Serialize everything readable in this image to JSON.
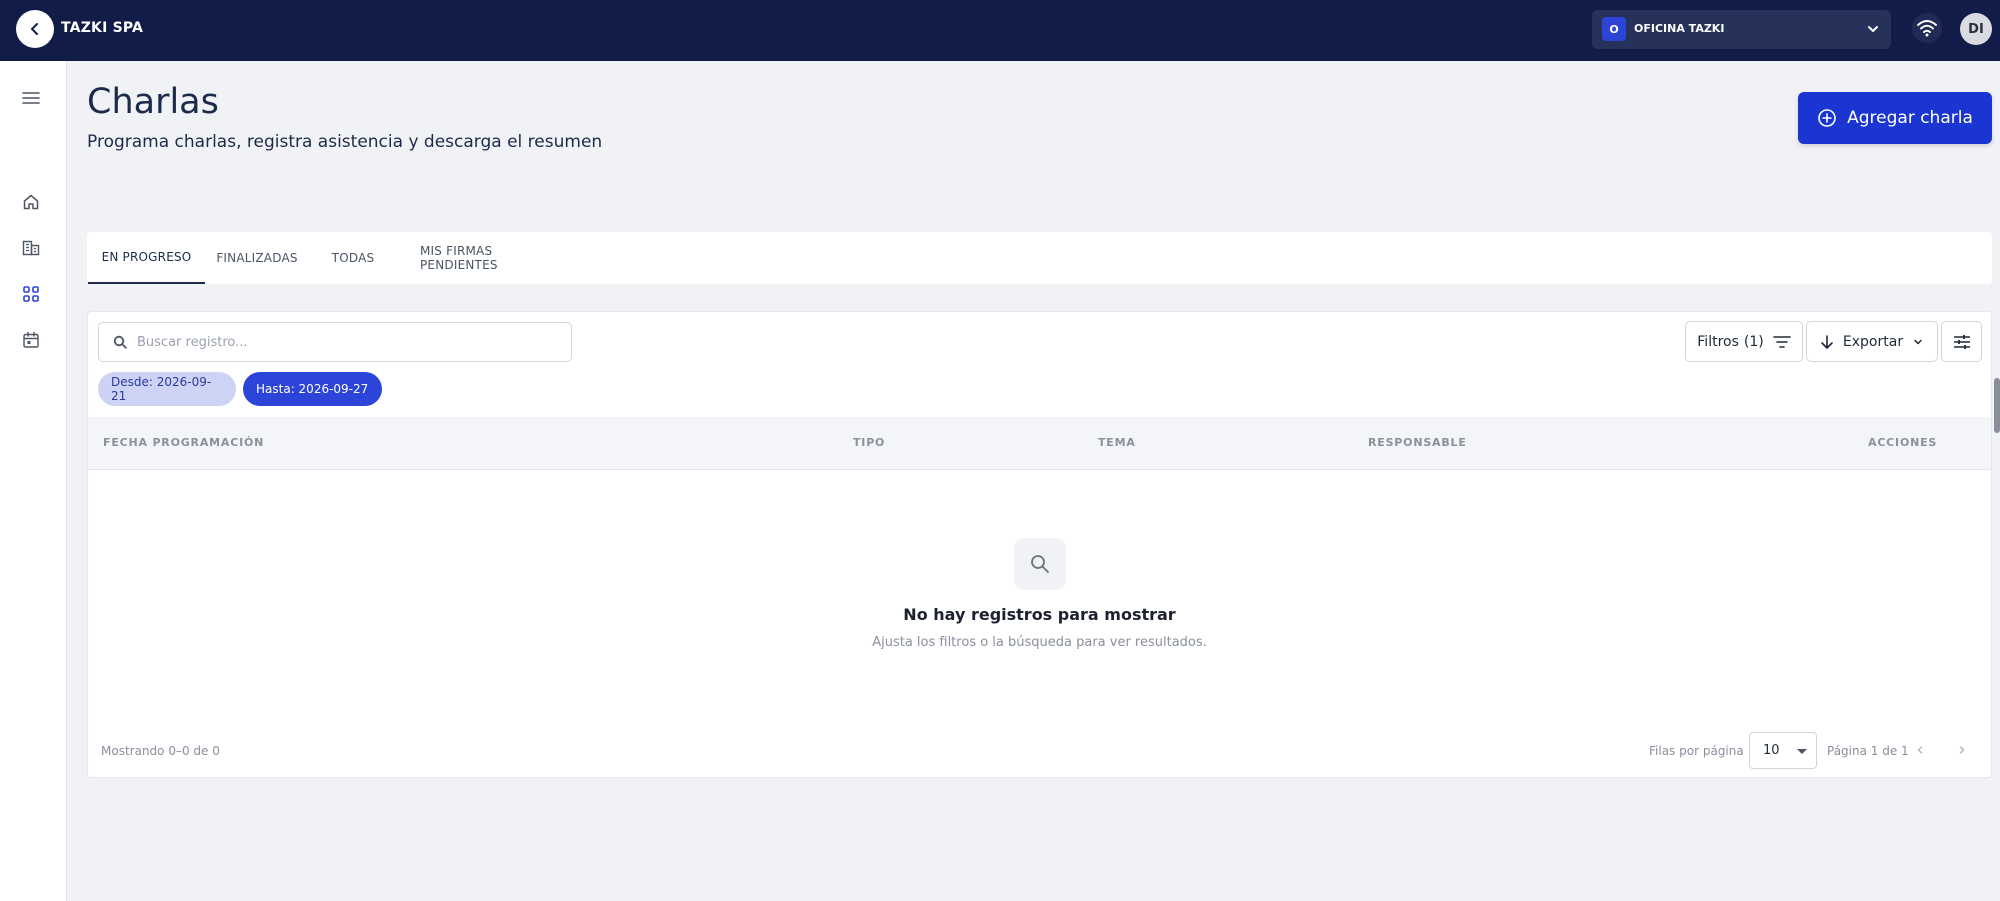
{
  "topbar": {
    "company": "TAZKI SPA",
    "office": {
      "badge": "O",
      "name": "OFICINA TAZKI"
    },
    "avatar": "DI"
  },
  "sidebar": {
    "items": [
      {
        "icon": "menu-icon"
      },
      {
        "icon": "home-icon"
      },
      {
        "icon": "building-icon"
      },
      {
        "icon": "grid-icon",
        "active": true
      },
      {
        "icon": "calendar-icon"
      }
    ]
  },
  "header": {
    "title": "Charlas",
    "subtitle": "Programa charlas, registra asistencia y descarga el resumen",
    "add_button": "Agregar charla"
  },
  "tabs": [
    {
      "label": "EN PROGRESO",
      "active": true
    },
    {
      "label": "FINALIZADAS"
    },
    {
      "label": "TODAS"
    },
    {
      "label": "MIS FIRMAS PENDIENTES"
    }
  ],
  "toolbar": {
    "search_placeholder": "Buscar registro...",
    "filters_label": "Filtros",
    "filters_count": "(1)",
    "export_label": "Exportar"
  },
  "chips": {
    "from": "Desde: 2026-09-21",
    "to": "Hasta: 2026-09-27"
  },
  "table": {
    "columns": [
      "FECHA PROGRAMACIÓN",
      "TIPO",
      "TEMA",
      "RESPONSABLE",
      "ACCIONES"
    ],
    "empty_title": "No hay registros para mostrar",
    "empty_subtitle": "Ajusta los filtros o la búsqueda para ver resultados."
  },
  "pagination": {
    "showing": "Mostrando 0–0 de 0",
    "rows_label": "Filas por página",
    "rows_value": "10",
    "page_label": "Página 1 de 1"
  },
  "colors": {
    "topbar": "#111d48",
    "primary": "#1a35d1",
    "chip_active": "#2c44d8",
    "chip_inactive": "#cdd3f5"
  }
}
